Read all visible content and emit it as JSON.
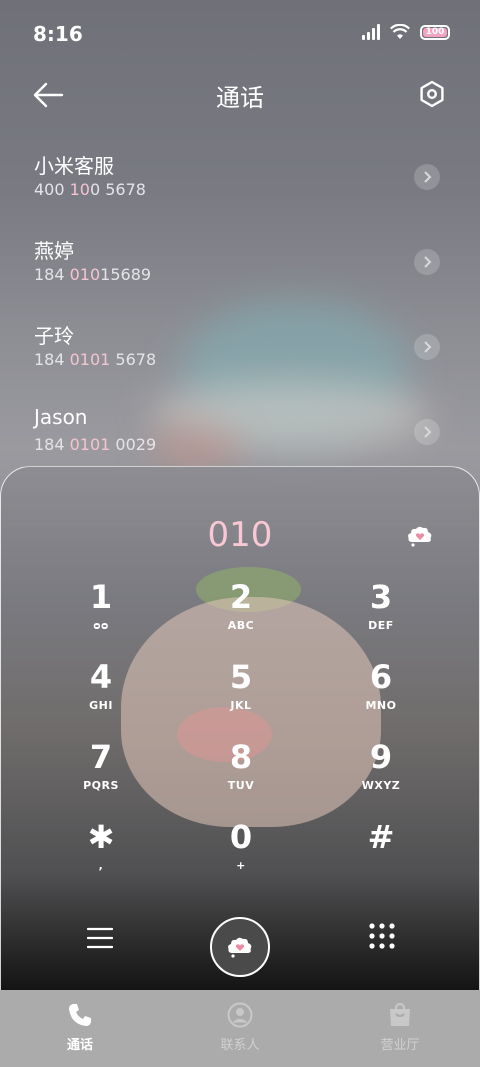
{
  "status_bar": {
    "time": "8:16",
    "battery": "100"
  },
  "header": {
    "title": "通话"
  },
  "contacts": [
    {
      "name": "小米客服",
      "number_pre": "400 ",
      "number_match": "10",
      "number_post": "0 5678"
    },
    {
      "name": "燕婷",
      "number_pre": "184 ",
      "number_match": "010",
      "number_post": "15689"
    },
    {
      "name": "子玲",
      "number_pre": "184 ",
      "number_match": "0101",
      "number_post": " 5678"
    },
    {
      "name": "Jason",
      "number_pre": "184 ",
      "number_match": "0101",
      "number_post": " 0029"
    }
  ],
  "dialpad": {
    "input": "010",
    "keys": [
      {
        "digit": "1",
        "letters": "ᴑᴑ"
      },
      {
        "digit": "2",
        "letters": "ABC"
      },
      {
        "digit": "3",
        "letters": "DEF"
      },
      {
        "digit": "4",
        "letters": "GHI"
      },
      {
        "digit": "5",
        "letters": "JKL"
      },
      {
        "digit": "6",
        "letters": "MNO"
      },
      {
        "digit": "7",
        "letters": "PQRS"
      },
      {
        "digit": "8",
        "letters": "TUV"
      },
      {
        "digit": "9",
        "letters": "WXYZ"
      },
      {
        "digit": "✱",
        "letters": ","
      },
      {
        "digit": "0",
        "letters": "+"
      },
      {
        "digit": "#",
        "letters": ""
      }
    ]
  },
  "nav": {
    "calls": "通话",
    "contacts": "联系人",
    "store": "营业厅"
  },
  "colors": {
    "match_highlight": "#f4c4cf",
    "nav_bg": "#ababab"
  }
}
